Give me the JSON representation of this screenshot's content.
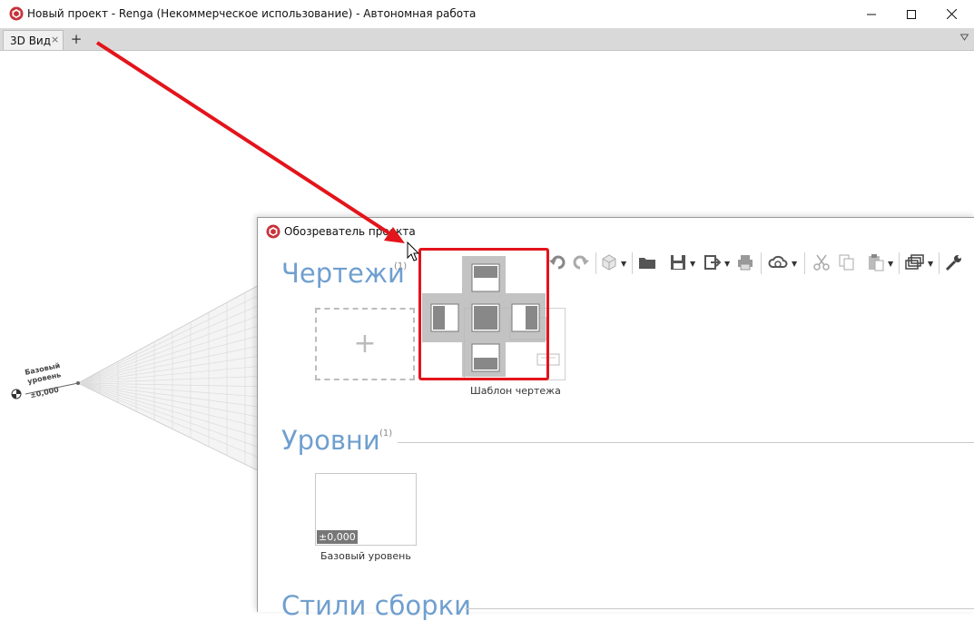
{
  "window": {
    "title": "Новый проект - Renga (Некоммерческое использование) - Автономная работа",
    "controls": [
      "minimize-icon",
      "maximize-icon",
      "close-icon"
    ]
  },
  "tabs": [
    {
      "label": "3D Вид",
      "close": "×"
    }
  ],
  "tab_add": "+",
  "scene": {
    "level_label_line1": "Базовый",
    "level_label_line2": "уровень",
    "level_value": "±0,000"
  },
  "browser": {
    "title": "Обозреватель проекта",
    "toolbar_icons": [
      "undo-icon",
      "redo-icon",
      "cube-icon",
      "open-folder-icon",
      "save-icon",
      "export-icon",
      "print-icon",
      "cloud-sync-icon",
      "cut-icon",
      "copy-icon",
      "paste-icon",
      "windows-icon",
      "settings-wrench-icon"
    ],
    "sections": [
      {
        "title": "Чертежи",
        "count": "(1)",
        "add_label": "+",
        "items": [
          {
            "caption": "Шаблон чертежа"
          }
        ]
      },
      {
        "title": "Уровни",
        "count": "(1)",
        "items": [
          {
            "caption": "Базовый уровень",
            "badge": "±0,000"
          }
        ]
      },
      {
        "title": "Стили сборки"
      }
    ]
  },
  "colors": {
    "accent_title": "#6f9fcf",
    "annotation_red": "#e3141b",
    "tab_bar": "#d9d9d9"
  }
}
